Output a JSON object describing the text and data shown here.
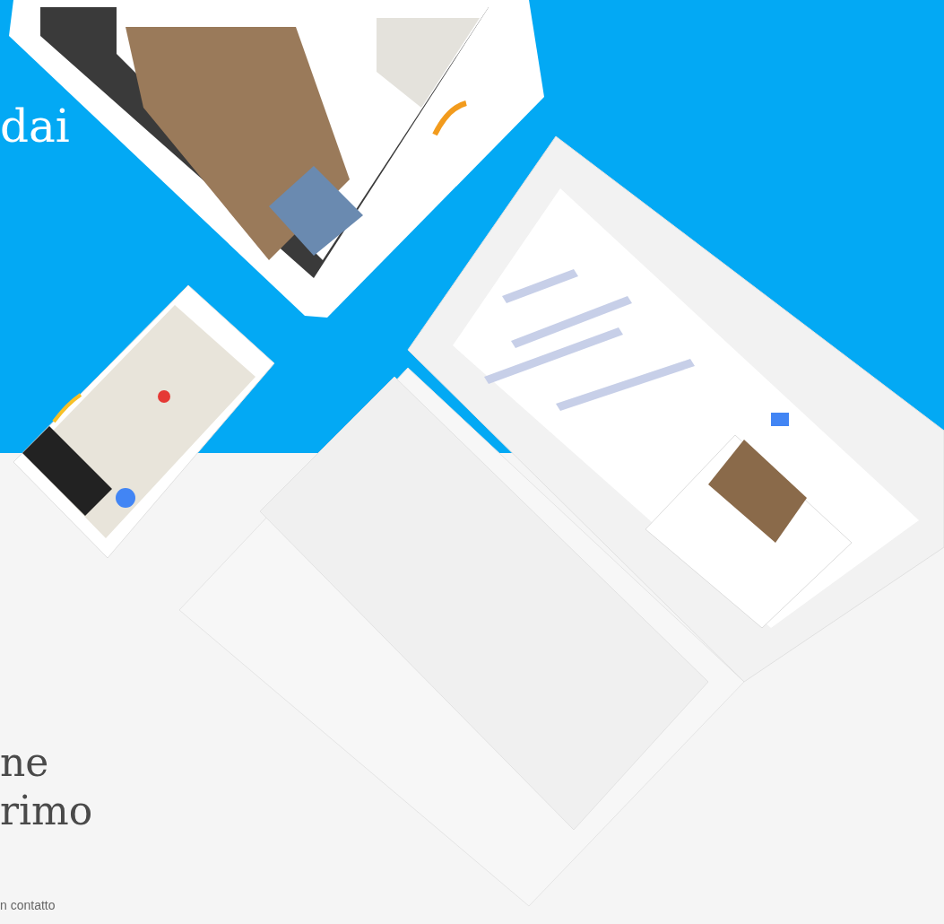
{
  "hero": {
    "heading_fragment": "dai"
  },
  "lower": {
    "heading_lines": [
      "ne",
      "rimo"
    ],
    "contact_text": "n contatto"
  }
}
